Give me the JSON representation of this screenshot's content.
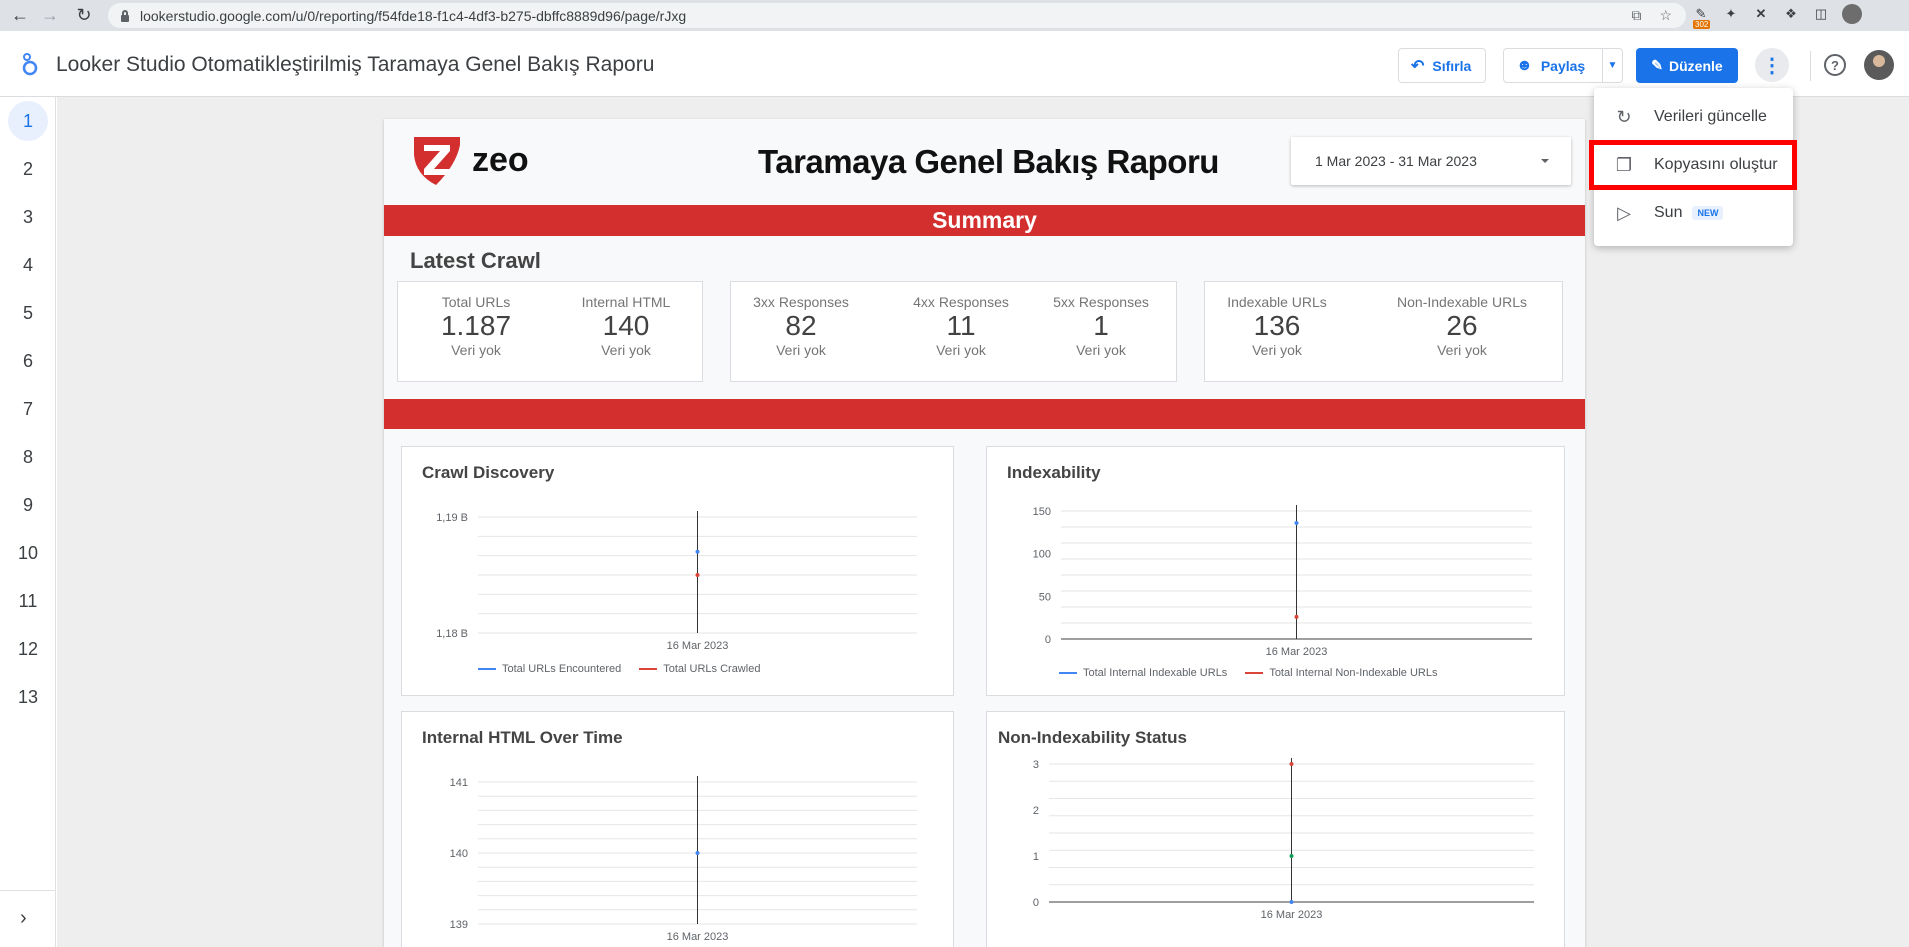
{
  "browser": {
    "url": "lookerstudio.google.com/u/0/reporting/f54fde18-f1c4-4df3-b275-dbffc8889d96/page/rJxg",
    "ext_badge": "302"
  },
  "header": {
    "title": "Looker Studio Otomatikleştirilmiş Taramaya Genel Bakış Raporu",
    "reset_label": "Sıfırla",
    "share_label": "Paylaş",
    "edit_label": "Düzenle",
    "help_glyph": "?"
  },
  "pages": [
    "1",
    "2",
    "3",
    "4",
    "5",
    "6",
    "7",
    "8",
    "9",
    "10",
    "11",
    "12",
    "13"
  ],
  "report": {
    "title": "Taramaya Genel Bakış Raporu",
    "logo_text": "zeo",
    "date_range": "1 Mar 2023 - 31 Mar 2023",
    "summary_label": "Summary",
    "latest_crawl_label": "Latest Crawl",
    "kpis": [
      {
        "label": "Total URLs",
        "value": "1.187",
        "sub": "Veri yok"
      },
      {
        "label": "Internal HTML",
        "value": "140",
        "sub": "Veri yok"
      },
      {
        "label": "3xx Responses",
        "value": "82",
        "sub": "Veri yok"
      },
      {
        "label": "4xx Responses",
        "value": "11",
        "sub": "Veri yok"
      },
      {
        "label": "5xx Responses",
        "value": "1",
        "sub": "Veri yok"
      },
      {
        "label": "Indexable URLs",
        "value": "136",
        "sub": "Veri yok"
      },
      {
        "label": "Non-Indexable URLs",
        "value": "26",
        "sub": "Veri yok"
      }
    ]
  },
  "menu": {
    "items": [
      {
        "label": "Verileri güncelle",
        "icon": "refresh-icon"
      },
      {
        "label": "Kopyasını oluştur",
        "icon": "copy-icon"
      },
      {
        "label": "Sun",
        "icon": "present-icon",
        "badge": "NEW"
      }
    ]
  },
  "colors": {
    "accent": "#1a73e8",
    "brand_red": "#d32f2f",
    "series_blue": "#4285f4",
    "series_red": "#db4437",
    "series_green": "#0f9d58"
  },
  "chart_data": [
    {
      "type": "line",
      "title": "Crawl Discovery",
      "x": [
        "16 Mar 2023"
      ],
      "yticks": [
        "1,19 B",
        "1,18 B"
      ],
      "series": [
        {
          "name": "Total URLs Encountered",
          "color": "#4285f4",
          "values": [
            1187
          ]
        },
        {
          "name": "Total URLs Crawled",
          "color": "#db4437",
          "values": [
            1185
          ]
        }
      ]
    },
    {
      "type": "line",
      "title": "Indexability",
      "x": [
        "16 Mar 2023"
      ],
      "ylim": [
        0,
        150
      ],
      "yticks": [
        "150",
        "100",
        "50",
        "0"
      ],
      "series": [
        {
          "name": "Total Internal Indexable URLs",
          "color": "#4285f4",
          "values": [
            136
          ]
        },
        {
          "name": "Total Internal Non-Indexable URLs",
          "color": "#db4437",
          "values": [
            26
          ]
        }
      ]
    },
    {
      "type": "line",
      "title": "Internal HTML Over Time",
      "x": [
        "16 Mar 2023"
      ],
      "ylim": [
        139,
        141
      ],
      "yticks": [
        "141",
        "140",
        "139"
      ],
      "series": [
        {
          "color": "#4285f4",
          "values": [
            140
          ]
        }
      ]
    },
    {
      "type": "line",
      "title": "Non-Indexability Status",
      "x": [
        "16 Mar 2023"
      ],
      "ylim": [
        0,
        3
      ],
      "yticks": [
        "3",
        "2",
        "1",
        "0"
      ],
      "series": [
        {
          "color": "#db4437",
          "values": [
            3
          ]
        },
        {
          "color": "#0f9d58",
          "values": [
            1
          ]
        },
        {
          "color": "#4285f4",
          "values": [
            0
          ]
        }
      ]
    }
  ]
}
